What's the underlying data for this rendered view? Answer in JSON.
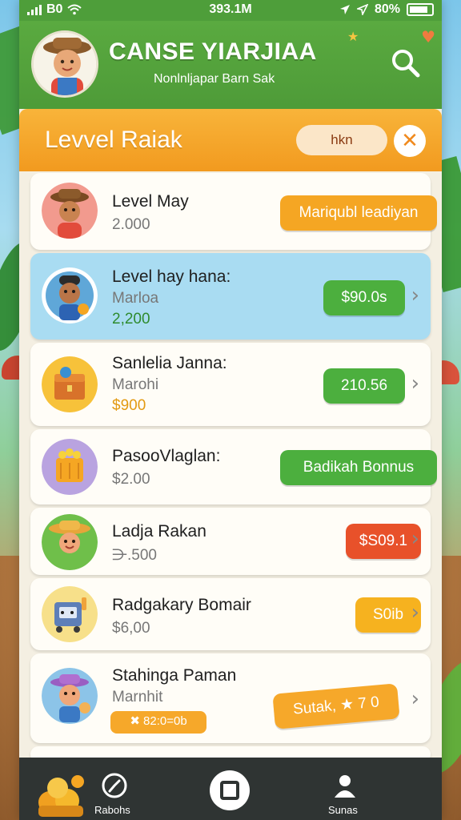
{
  "status_bar": {
    "signal": "B0",
    "time": "393.1M",
    "battery": "80%"
  },
  "header": {
    "title": "CANSE YIARJIAA",
    "subtitle": "Nonlnljapar Barn Sak"
  },
  "level_bar": {
    "title": "Levvel Raiak",
    "pill": "hkn",
    "close": "✕"
  },
  "rows": [
    {
      "name": "Level May",
      "subtitle": "",
      "value": "2.000",
      "value_color": "#777777",
      "button": "Mariqubl leadiyan",
      "button_color": "#f5a623",
      "chevron": ""
    },
    {
      "name": "Level hay hana:",
      "subtitle": "Marloa",
      "value": "2,200",
      "value_color": "#2e8b2e",
      "button": "$90.0s",
      "button_color": "#4caf3e",
      "chevron": "›"
    },
    {
      "name": "Sanlelia Janna:",
      "subtitle": "Marohi",
      "value": "$900",
      "value_color": "#e39a12",
      "button": "210.56",
      "button_color": "#4caf3e",
      "chevron": "›"
    },
    {
      "name": "PasooVlaglan:",
      "subtitle": "",
      "value": "$2.00",
      "value_color": "#777777",
      "button": "Badikah Bonnus",
      "button_color": "#4caf3e",
      "chevron": ""
    },
    {
      "name": "Ladja Rakan",
      "subtitle": "",
      "value": "⋺.500",
      "value_color": "#777777",
      "button": "$S09.1",
      "button_color": "#e8512a",
      "chevron": "›"
    },
    {
      "name": "Radgakary Bomair",
      "subtitle": "",
      "value": "$6,00",
      "value_color": "#777777",
      "button": "S0ib",
      "button_color": "#f6b21f",
      "chevron": "›"
    },
    {
      "name": "Stahinga Paman",
      "subtitle": "Marnhit",
      "value": "✖ 82:0=0b",
      "value_color": "#ffffff",
      "button": "Sutak, ★ 7 0",
      "button_color": "#f6a82a",
      "chevron": "›"
    }
  ],
  "nav": {
    "left_label": "Rabohs",
    "right_label": "Sunas"
  },
  "colors": {
    "header_green": "#4e9b38",
    "ribbon_orange": "#f29a1f",
    "selected_row": "#a9dcf2",
    "nav_dark": "#2f3433"
  },
  "icons": [
    "signal-bars-icon",
    "wifi-icon",
    "location-arrow-icon",
    "battery-icon",
    "search-icon",
    "close-icon",
    "chevron-right-icon",
    "clock-icon",
    "home-square-icon",
    "user-icon"
  ]
}
